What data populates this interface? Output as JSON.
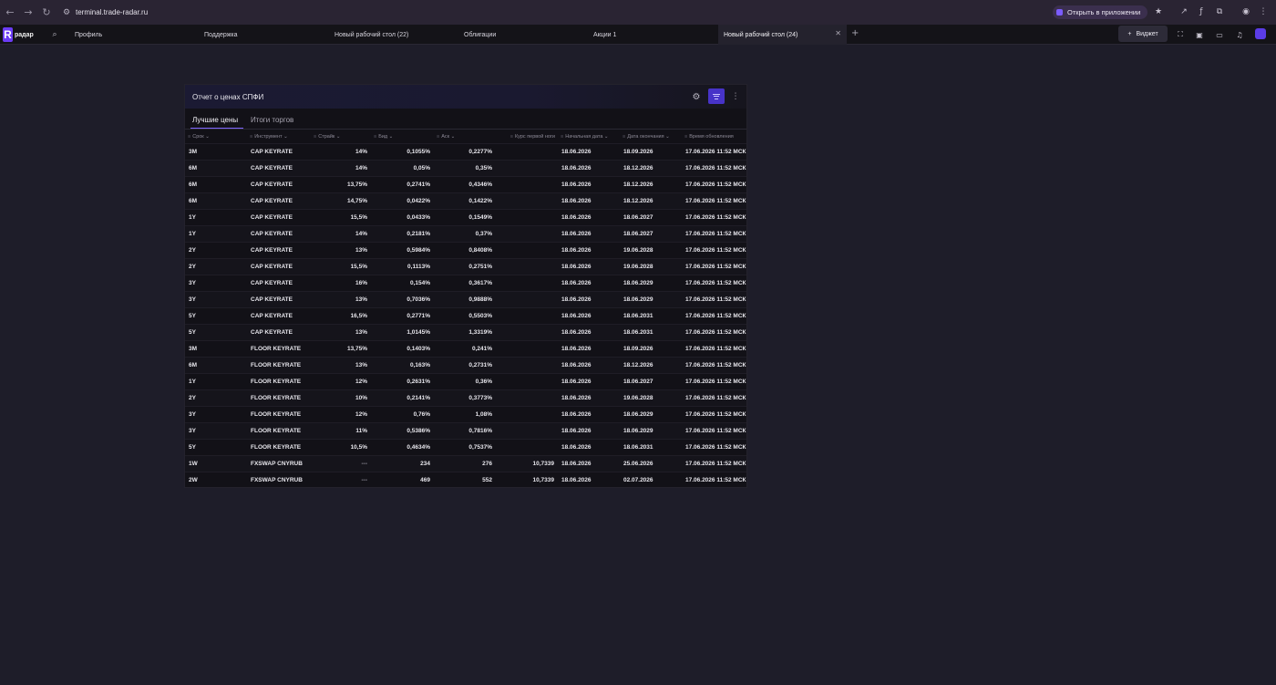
{
  "browser": {
    "url": "terminal.trade-radar.ru",
    "open_in_app": "Открыть в приложении"
  },
  "app": {
    "logo_text": "радар",
    "tabs": [
      {
        "label": "Профиль"
      },
      {
        "label": "Поддержка"
      },
      {
        "label": "Новый рабочий стол (22)"
      },
      {
        "label": "Облигации"
      },
      {
        "label": "Акции 1"
      },
      {
        "label": "Новый рабочий стол (24)"
      }
    ],
    "widget_button": "Виджет"
  },
  "widget": {
    "title": "Отчет о ценах СПФИ",
    "subtabs": [
      "Лучшие цены",
      "Итоги торгов"
    ],
    "columns": [
      "Срок",
      "Инструмент",
      "Страйк",
      "Бид",
      "Аск",
      "Курс первой ноги",
      "Начальная дата",
      "Дата окончания",
      "Время обновления"
    ],
    "rows": [
      [
        "3M",
        "CAP KEYRATE",
        "14%",
        "0,1055%",
        "0,2277%",
        "",
        "18.06.2026",
        "18.09.2026",
        "17.06.2026 11:52 МСК"
      ],
      [
        "6M",
        "CAP KEYRATE",
        "14%",
        "0,05%",
        "0,35%",
        "",
        "18.06.2026",
        "18.12.2026",
        "17.06.2026 11:52 МСК"
      ],
      [
        "6M",
        "CAP KEYRATE",
        "13,75%",
        "0,2741%",
        "0,4346%",
        "",
        "18.06.2026",
        "18.12.2026",
        "17.06.2026 11:52 МСК"
      ],
      [
        "6M",
        "CAP KEYRATE",
        "14,75%",
        "0,0422%",
        "0,1422%",
        "",
        "18.06.2026",
        "18.12.2026",
        "17.06.2026 11:52 МСК"
      ],
      [
        "1Y",
        "CAP KEYRATE",
        "15,5%",
        "0,0433%",
        "0,1549%",
        "",
        "18.06.2026",
        "18.06.2027",
        "17.06.2026 11:52 МСК"
      ],
      [
        "1Y",
        "CAP KEYRATE",
        "14%",
        "0,2181%",
        "0,37%",
        "",
        "18.06.2026",
        "18.06.2027",
        "17.06.2026 11:52 МСК"
      ],
      [
        "2Y",
        "CAP KEYRATE",
        "13%",
        "0,5984%",
        "0,8408%",
        "",
        "18.06.2026",
        "19.06.2028",
        "17.06.2026 11:52 МСК"
      ],
      [
        "2Y",
        "CAP KEYRATE",
        "15,5%",
        "0,1113%",
        "0,2751%",
        "",
        "18.06.2026",
        "19.06.2028",
        "17.06.2026 11:52 МСК"
      ],
      [
        "3Y",
        "CAP KEYRATE",
        "16%",
        "0,154%",
        "0,3617%",
        "",
        "18.06.2026",
        "18.06.2029",
        "17.06.2026 11:52 МСК"
      ],
      [
        "3Y",
        "CAP KEYRATE",
        "13%",
        "0,7036%",
        "0,9888%",
        "",
        "18.06.2026",
        "18.06.2029",
        "17.06.2026 11:52 МСК"
      ],
      [
        "5Y",
        "CAP KEYRATE",
        "16,5%",
        "0,2771%",
        "0,5503%",
        "",
        "18.06.2026",
        "18.06.2031",
        "17.06.2026 11:52 МСК"
      ],
      [
        "5Y",
        "CAP KEYRATE",
        "13%",
        "1,0145%",
        "1,3319%",
        "",
        "18.06.2026",
        "18.06.2031",
        "17.06.2026 11:52 МСК"
      ],
      [
        "3M",
        "FLOOR KEYRATE",
        "13,75%",
        "0,1403%",
        "0,241%",
        "",
        "18.06.2026",
        "18.09.2026",
        "17.06.2026 11:52 МСК"
      ],
      [
        "6M",
        "FLOOR KEYRATE",
        "13%",
        "0,163%",
        "0,2731%",
        "",
        "18.06.2026",
        "18.12.2026",
        "17.06.2026 11:52 МСК"
      ],
      [
        "1Y",
        "FLOOR KEYRATE",
        "12%",
        "0,2631%",
        "0,36%",
        "",
        "18.06.2026",
        "18.06.2027",
        "17.06.2026 11:52 МСК"
      ],
      [
        "2Y",
        "FLOOR KEYRATE",
        "10%",
        "0,2141%",
        "0,3773%",
        "",
        "18.06.2026",
        "19.06.2028",
        "17.06.2026 11:52 МСК"
      ],
      [
        "3Y",
        "FLOOR KEYRATE",
        "12%",
        "0,76%",
        "1,08%",
        "",
        "18.06.2026",
        "18.06.2029",
        "17.06.2026 11:52 МСК"
      ],
      [
        "3Y",
        "FLOOR KEYRATE",
        "11%",
        "0,5386%",
        "0,7816%",
        "",
        "18.06.2026",
        "18.06.2029",
        "17.06.2026 11:52 МСК"
      ],
      [
        "5Y",
        "FLOOR KEYRATE",
        "10,5%",
        "0,4634%",
        "0,7537%",
        "",
        "18.06.2026",
        "18.06.2031",
        "17.06.2026 11:52 МСК"
      ],
      [
        "1W",
        "FXSWAP CNYRUB",
        "---",
        "234",
        "276",
        "10,7339",
        "18.06.2026",
        "25.06.2026",
        "17.06.2026 11:52 МСК"
      ],
      [
        "2W",
        "FXSWAP CNYRUB",
        "---",
        "469",
        "552",
        "10,7339",
        "18.06.2026",
        "02.07.2026",
        "17.06.2026 11:52 МСК"
      ]
    ]
  }
}
